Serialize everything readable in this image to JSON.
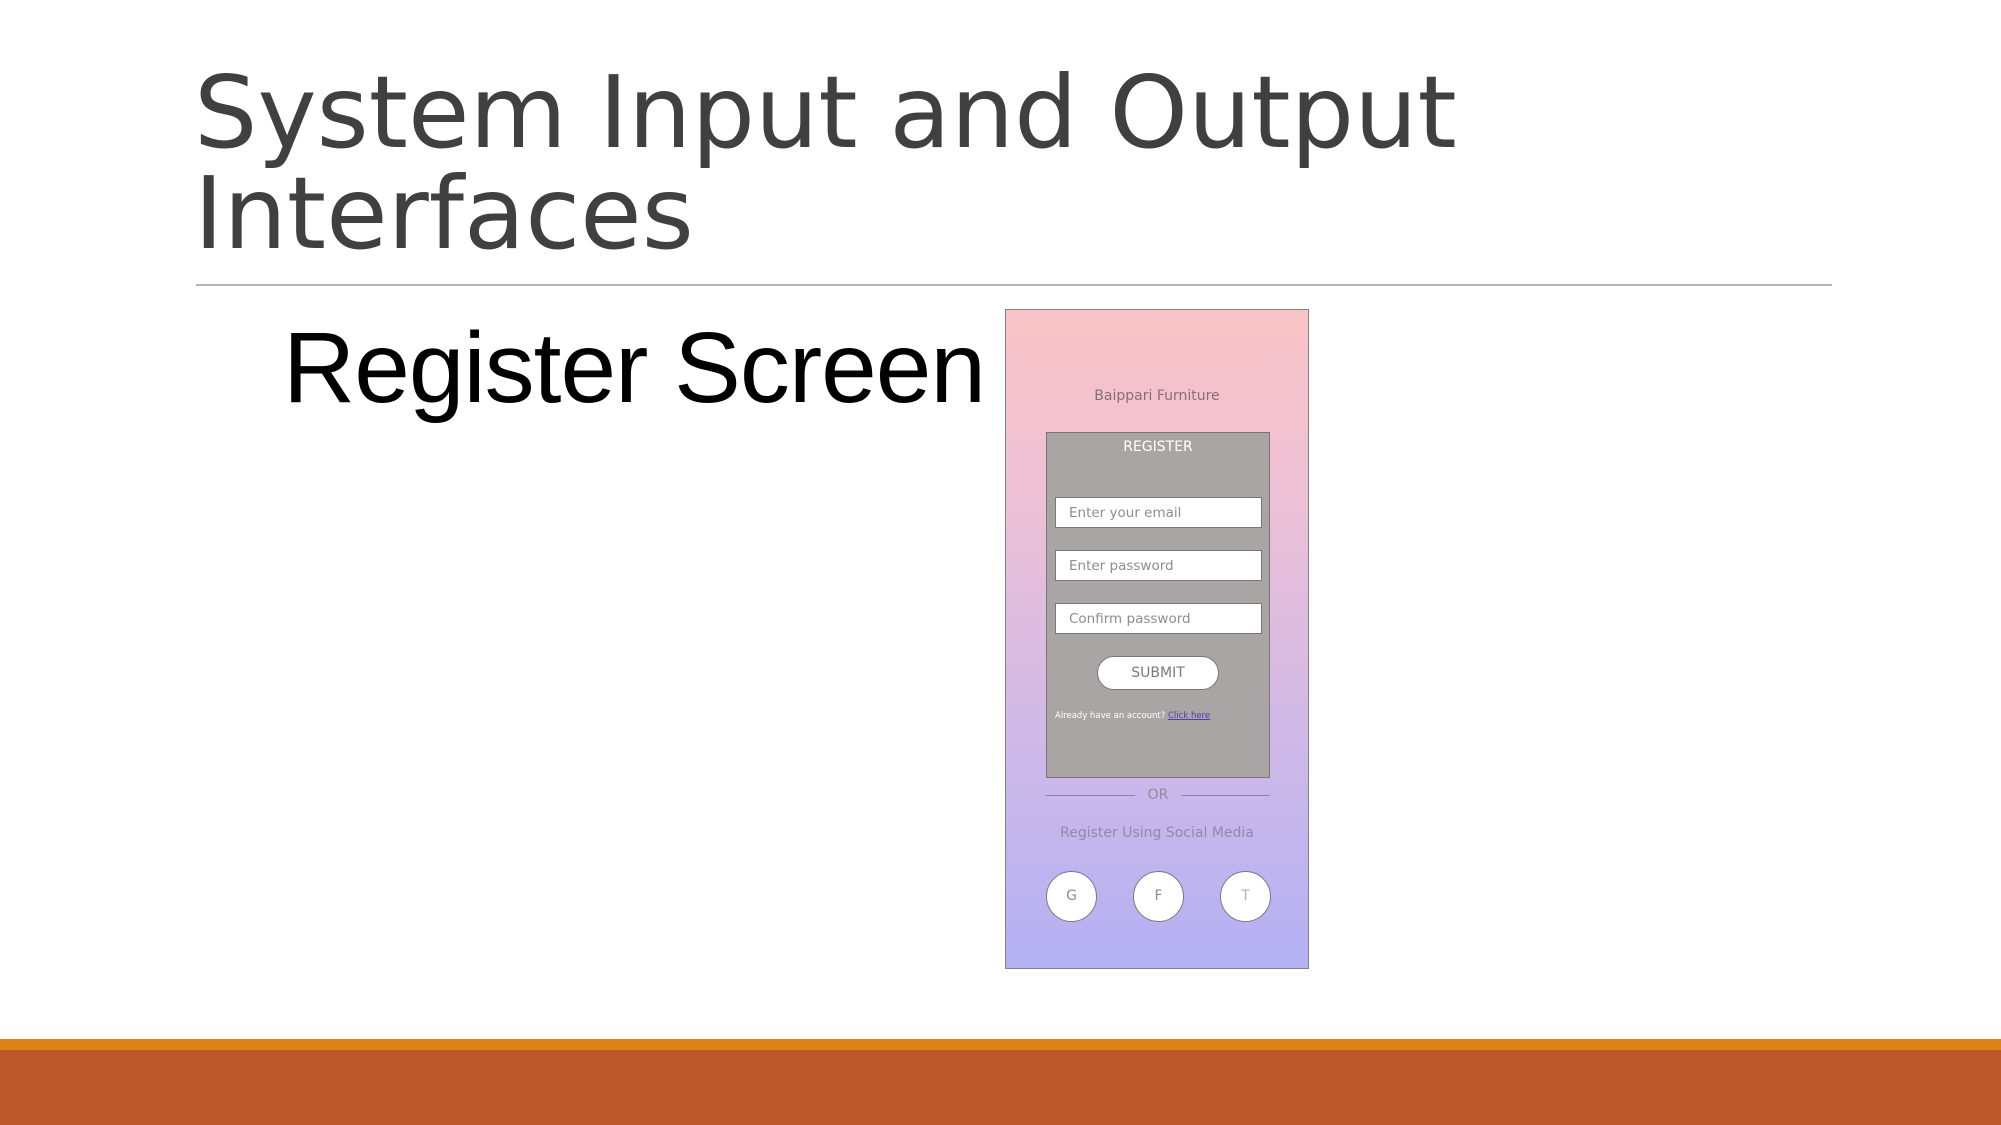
{
  "slide": {
    "title_line1": "System Input and Output",
    "title_line2": "Interfaces",
    "subtitle": "Register Screen"
  },
  "mockup": {
    "brand": "Baippari Furniture",
    "register_heading": "REGISTER",
    "fields": {
      "email_placeholder": "Enter your email",
      "password_placeholder": "Enter password",
      "confirm_placeholder": "Confirm password"
    },
    "submit_label": "SUBMIT",
    "account_prompt": "Already have an account?",
    "account_link": "Click here",
    "or_label": "OR",
    "social_heading": "Register Using Social Media",
    "social_buttons": [
      {
        "label": "G",
        "icon": "google-icon"
      },
      {
        "label": "F",
        "icon": "facebook-icon"
      },
      {
        "label": "T",
        "icon": "twitter-icon"
      }
    ],
    "colors": {
      "gradient_top": "#f9c4c6",
      "gradient_bottom": "#b3b1f4",
      "form_box": "#aaa5a5",
      "link": "#4b3fb4"
    }
  },
  "theme": {
    "title_color": "#404040",
    "footer_accent": "#df8215",
    "footer_band": "#bb582c"
  }
}
